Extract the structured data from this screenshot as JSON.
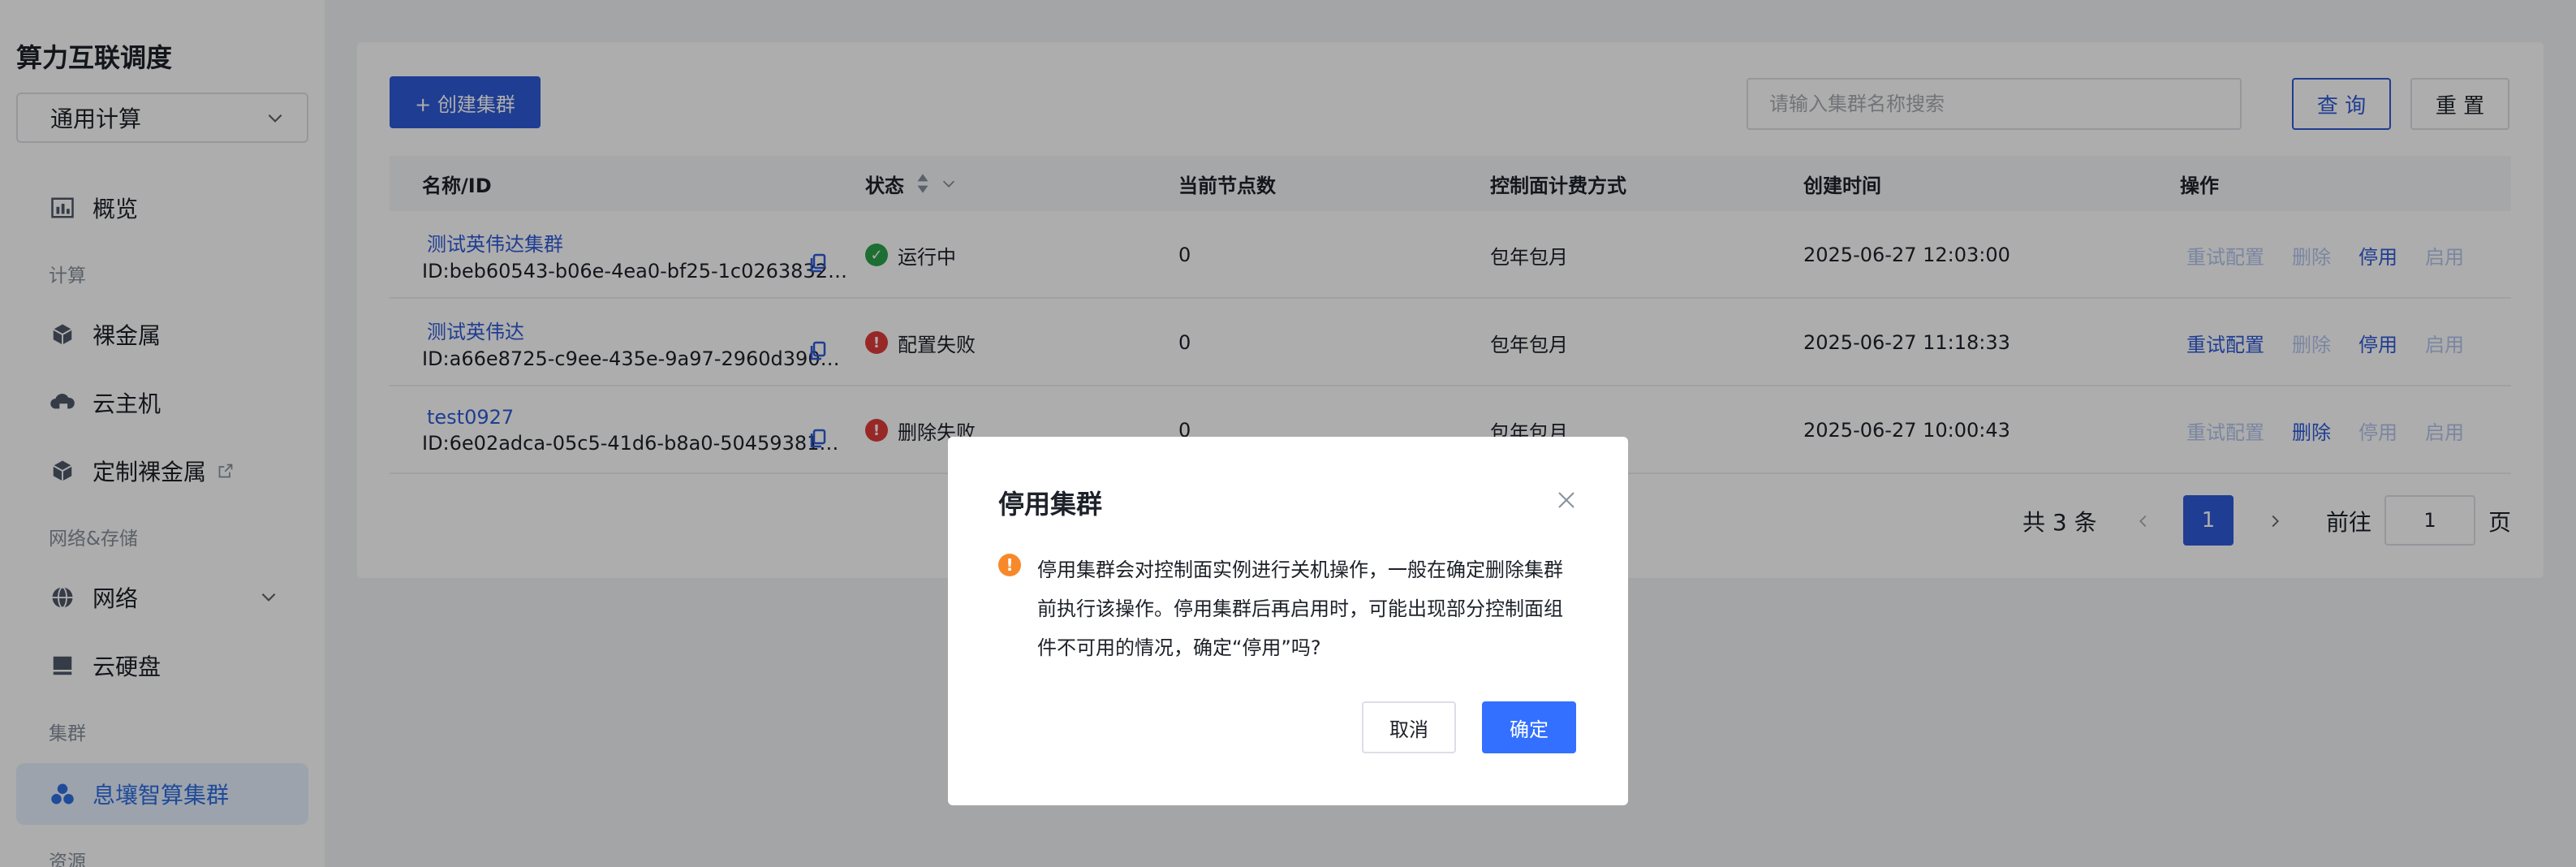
{
  "brand": "算力互联调度",
  "sidebar": {
    "select_value": "通用计算",
    "items": [
      {
        "label": "概览",
        "icon": "chart-icon"
      },
      {
        "label": "裸金属",
        "icon": "cube-icon"
      },
      {
        "label": "云主机",
        "icon": "cloud-host-icon"
      },
      {
        "label": "定制裸金属",
        "icon": "cube-icon"
      },
      {
        "label": "网络",
        "icon": "globe-icon"
      },
      {
        "label": "云硬盘",
        "icon": "disk-icon"
      },
      {
        "label": "息壤智算集群",
        "icon": "cluster-icon"
      }
    ],
    "groups": [
      "计算",
      "网络&存储",
      "集群",
      "资源"
    ]
  },
  "toolbar": {
    "create_label": "+ 创建集群",
    "search_placeholder": "请输入集群名称搜索",
    "query_label": "查 询",
    "reset_label": "重 置"
  },
  "table": {
    "headers": [
      "名称/ID",
      "状态",
      "当前节点数",
      "控制面计费方式",
      "创建时间",
      "操作"
    ],
    "rows": [
      {
        "name": "测试英伟达集群",
        "id": "ID:beb60543-b06e-4ea0-bf25-1c0263832…",
        "status": "运行中",
        "status_color": "#2ba24c",
        "nodes": "0",
        "billing": "包年包月",
        "created": "2025-06-27 12:03:00",
        "ops": [
          {
            "label": "重试配置",
            "enabled": false
          },
          {
            "label": "删除",
            "enabled": false
          },
          {
            "label": "停用",
            "enabled": true
          },
          {
            "label": "启用",
            "enabled": false
          }
        ]
      },
      {
        "name": "测试英伟达",
        "id": "ID:a66e8725-c9ee-435e-9a97-2960d390…",
        "status": "配置失败",
        "status_color": "#e03b3b",
        "nodes": "0",
        "billing": "包年包月",
        "created": "2025-06-27 11:18:33",
        "ops": [
          {
            "label": "重试配置",
            "enabled": true
          },
          {
            "label": "删除",
            "enabled": false
          },
          {
            "label": "停用",
            "enabled": true
          },
          {
            "label": "启用",
            "enabled": false
          }
        ]
      },
      {
        "name": "test0927",
        "id": "ID:6e02adca-05c5-41d6-b8a0-50459381…",
        "status": "删除失败",
        "status_color": "#e03b3b",
        "nodes": "0",
        "billing": "包年包月",
        "created": "2025-06-27 10:00:43",
        "ops": [
          {
            "label": "重试配置",
            "enabled": false
          },
          {
            "label": "删除",
            "enabled": true
          },
          {
            "label": "停用",
            "enabled": false
          },
          {
            "label": "启用",
            "enabled": false
          }
        ]
      }
    ]
  },
  "pagination": {
    "total_label": "共 3 条",
    "current_page": "1",
    "goto_label": "前往",
    "goto_value": "1",
    "page_suffix": "页"
  },
  "modal": {
    "title": "停用集群",
    "body": "停用集群会对控制面实例进行关机操作，一般在确定删除集群前执行该操作。停用集群后再启用时，可能出现部分控制面组件不可用的情况，确定“停用”吗?",
    "cancel_label": "取消",
    "ok_label": "确定",
    "warn_symbol": "!"
  },
  "colors": {
    "primary": "#2f5bd8",
    "modal_ok": "#3370ff",
    "warning": "#f7892b",
    "disabled_link": "#b5c6ee"
  }
}
